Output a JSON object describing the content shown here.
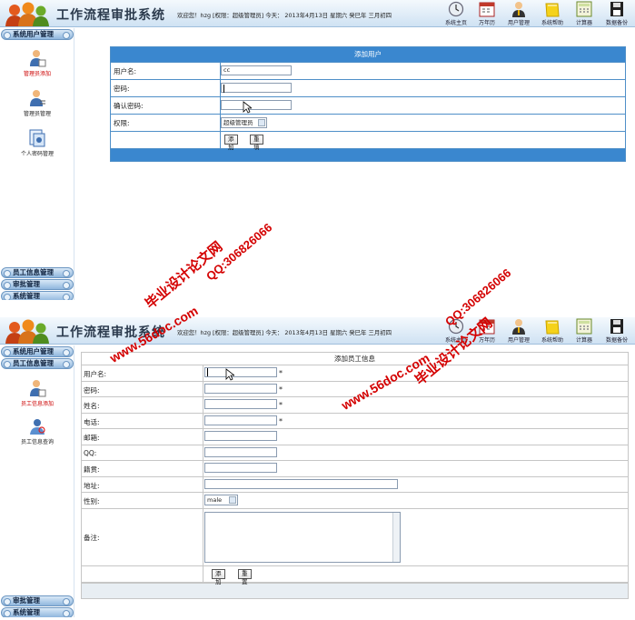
{
  "app_title": "工作流程审批系统",
  "welcome": "欢迎您！hzg [权限：超级管理员] 今天： 2013年4月13日 星期六 癸巳年 三月初四",
  "toolbar": [
    {
      "label": "系统主页",
      "icon": "clock-icon"
    },
    {
      "label": "万年历",
      "icon": "calendar-icon"
    },
    {
      "label": "用户管理",
      "icon": "user-icon"
    },
    {
      "label": "系统帮助",
      "icon": "help-folder-icon"
    },
    {
      "label": "计算器",
      "icon": "calculator-icon"
    },
    {
      "label": "数据备份",
      "icon": "floppy-disk-icon"
    }
  ],
  "screen1": {
    "sidebar": {
      "top_group": "系统用户管理",
      "items": [
        {
          "label": "管理员添加",
          "active": true
        },
        {
          "label": "管理员管理",
          "active": false
        },
        {
          "label": "个人密码管理",
          "active": false
        }
      ],
      "bottom_groups": [
        "员工信息管理",
        "审批管理",
        "系统管理"
      ]
    },
    "form": {
      "title": "添加用户",
      "fields": [
        {
          "label": "用户名:",
          "value": "cc"
        },
        {
          "label": "密码:",
          "value": ""
        },
        {
          "label": "确认密码:",
          "value": ""
        },
        {
          "label": "权限:",
          "value": "超级管理员"
        }
      ],
      "buttons": {
        "add": "添加",
        "reset": "重填"
      }
    }
  },
  "screen2": {
    "sidebar": {
      "top_groups": [
        "系统用户管理",
        "员工信息管理"
      ],
      "items": [
        {
          "label": "员工信息添加",
          "active": true
        },
        {
          "label": "员工信息查询",
          "active": false
        }
      ],
      "bottom_groups": [
        "审批管理",
        "系统管理"
      ]
    },
    "form": {
      "title": "添加员工信息",
      "fields": [
        {
          "label": "用户名:",
          "value": "",
          "required": "*"
        },
        {
          "label": "密码:",
          "value": "",
          "required": "*"
        },
        {
          "label": "姓名:",
          "value": "",
          "required": "*"
        },
        {
          "label": "电话:",
          "value": "",
          "required": "*"
        },
        {
          "label": "邮箱:",
          "value": ""
        },
        {
          "label": "QQ:",
          "value": ""
        },
        {
          "label": "籍贯:",
          "value": ""
        },
        {
          "label": "地址:",
          "value": ""
        },
        {
          "label": "性别:",
          "value": "male"
        },
        {
          "label": "备注:",
          "value": ""
        }
      ],
      "buttons": {
        "add": "添加",
        "reset": "重置"
      }
    }
  },
  "watermarks": {
    "site": "毕业设计论文网",
    "qq": "QQ:306826066",
    "url": "www.56doc.com"
  },
  "colors": {
    "panel_header": "#3a87cf",
    "watermark": "#d40000"
  }
}
